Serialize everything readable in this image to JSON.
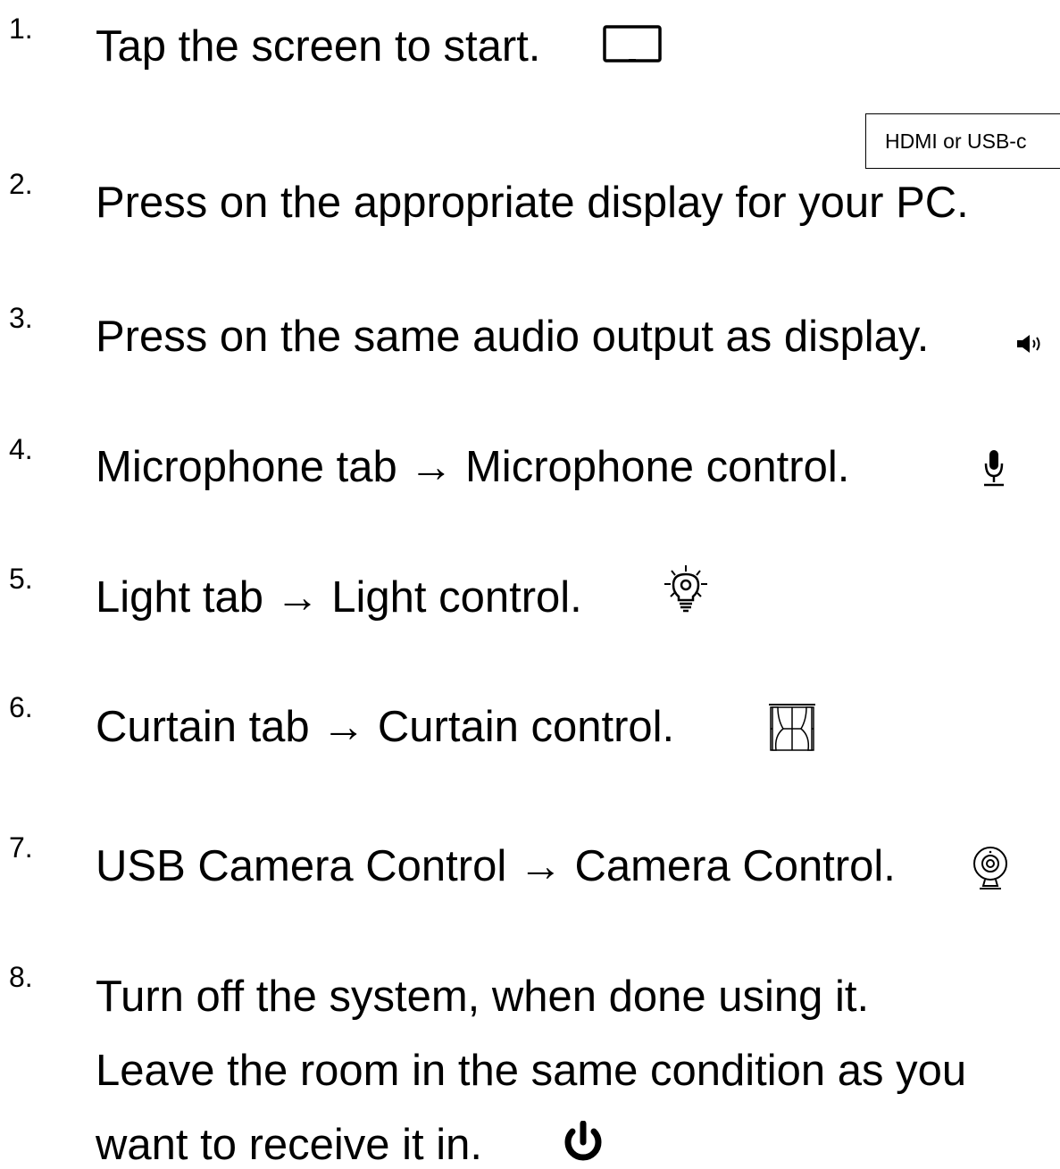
{
  "steps": [
    {
      "num": "1.",
      "text": "Tap the screen to start.",
      "icon": "tablet-icon"
    },
    {
      "num": "2.",
      "text": "Press on the appropriate display for your PC.",
      "icon": ""
    },
    {
      "num": "3.",
      "text": "Press on the same audio output as display.",
      "icon": "speaker-icon"
    },
    {
      "num": "4.",
      "text": "Microphone tab → Microphone control.",
      "icon": "microphone-icon"
    },
    {
      "num": "5.",
      "text": "Light tab → Light control.",
      "icon": "light-bulb-icon"
    },
    {
      "num": "6.",
      "text": "Curtain tab → Curtain control.",
      "icon": "curtain-icon"
    },
    {
      "num": "7.",
      "text": "USB Camera Control → Camera Control.",
      "icon": "webcam-icon"
    },
    {
      "num": "8.",
      "lines": [
        "Turn off the system, when done using it.",
        "Leave the room in the same condition as you",
        "want to receive it in."
      ],
      "icon": "power-icon"
    }
  ],
  "callout": {
    "text": "HDMI or USB-c"
  }
}
